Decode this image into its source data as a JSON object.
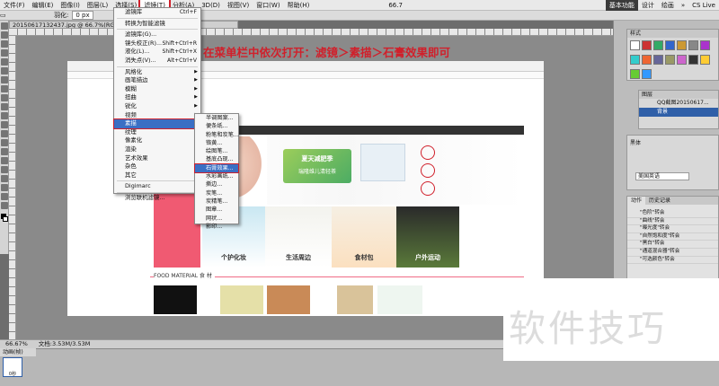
{
  "menubar": {
    "items": [
      "文件(F)",
      "编辑(E)",
      "图像(I)",
      "图层(L)",
      "选择(S)",
      "滤镜(T)",
      "分析(A)",
      "3D(D)",
      "视图(V)",
      "窗口(W)",
      "帮助(H)"
    ],
    "active_index": 5,
    "zoom": "66.7",
    "workspace_buttons": [
      "基本功能",
      "设计",
      "绘画",
      "»"
    ],
    "cs_live": "CS Live"
  },
  "options": {
    "feather_label": "羽化:",
    "feather_value": "0 px"
  },
  "document": {
    "tab_title": "20150617132437.jpg @ 66.7%(RGB/8#)",
    "instruction": "在菜单栏中依次打开：滤镜＞素描＞石膏效果即可"
  },
  "filter_menu": {
    "items": [
      {
        "label": "滤镜库",
        "shortcut": "Ctrl+F"
      },
      {
        "label": "转换为智能滤镜",
        "sep_before": true
      },
      {
        "label": "滤镜库(G)...",
        "sep_before": true
      },
      {
        "label": "镜头校正(R)...",
        "shortcut": "Shift+Ctrl+R"
      },
      {
        "label": "液化(L)...",
        "shortcut": "Shift+Ctrl+X"
      },
      {
        "label": "消失点(V)...",
        "shortcut": "Alt+Ctrl+V"
      },
      {
        "label": "风格化",
        "sep_before": true,
        "sub": true
      },
      {
        "label": "画笔描边",
        "sub": true
      },
      {
        "label": "模糊",
        "sub": true
      },
      {
        "label": "扭曲",
        "sub": true
      },
      {
        "label": "锐化",
        "sub": true
      },
      {
        "label": "视频",
        "sub": true
      },
      {
        "label": "素描",
        "sub": true,
        "highlight": true
      },
      {
        "label": "纹理",
        "sub": true
      },
      {
        "label": "像素化",
        "sub": true
      },
      {
        "label": "渲染",
        "sub": true
      },
      {
        "label": "艺术效果",
        "sub": true
      },
      {
        "label": "杂色",
        "sub": true
      },
      {
        "label": "其它",
        "sub": true
      },
      {
        "label": "Digimarc",
        "sep_before": true,
        "sub": true
      },
      {
        "label": "浏览联机滤镜...",
        "sep_before": true
      }
    ]
  },
  "sketch_menu": {
    "items": [
      {
        "label": "半调图案..."
      },
      {
        "label": "便条纸..."
      },
      {
        "label": "粉笔和炭笔..."
      },
      {
        "label": "铬黄..."
      },
      {
        "label": "绘图笔..."
      },
      {
        "label": "基底凸现..."
      },
      {
        "label": "石膏效果...",
        "highlight": true
      },
      {
        "label": "水彩画纸..."
      },
      {
        "label": "撕边..."
      },
      {
        "label": "炭笔..."
      },
      {
        "label": "炭精笔..."
      },
      {
        "label": "图章..."
      },
      {
        "label": "网状..."
      },
      {
        "label": "影印..."
      }
    ]
  },
  "webpage": {
    "banner_slogan": "夏天减肥季",
    "banner_sub": "瑞隆维儿清轻茶",
    "products": [
      "个护化妆",
      "生活周边",
      "食材包",
      "户外运动"
    ],
    "food_title": "FOOD MATERIAL 食 材"
  },
  "panels": {
    "swatch_tabs": "样式",
    "layers_label": "图层",
    "layer_rows": [
      "QQ截图20150617...",
      "背景"
    ],
    "char_font": "黑体",
    "char_lang": "美国英语",
    "actions_tabs": [
      "动作",
      "历史记录"
    ],
    "actions": [
      "\"色阶\"转会",
      "\"曲线\"转会",
      "\"曝光度\"转会",
      "\"自然饱和度\"转会",
      "\"黑白\"转会",
      "\"通道混合器\"转会",
      "\"可选颜色\"转会"
    ]
  },
  "status": {
    "zoom": "66.67%",
    "doc_size": "文档:3.53M/3.53M"
  },
  "animation": {
    "tab_label": "动画(帧)",
    "frame_time": "0秒"
  },
  "watermark": "软件技巧",
  "colors": {
    "accent_red": "#d0202b",
    "highlight_blue": "#3a6fc4",
    "pink": "#f05a72"
  }
}
